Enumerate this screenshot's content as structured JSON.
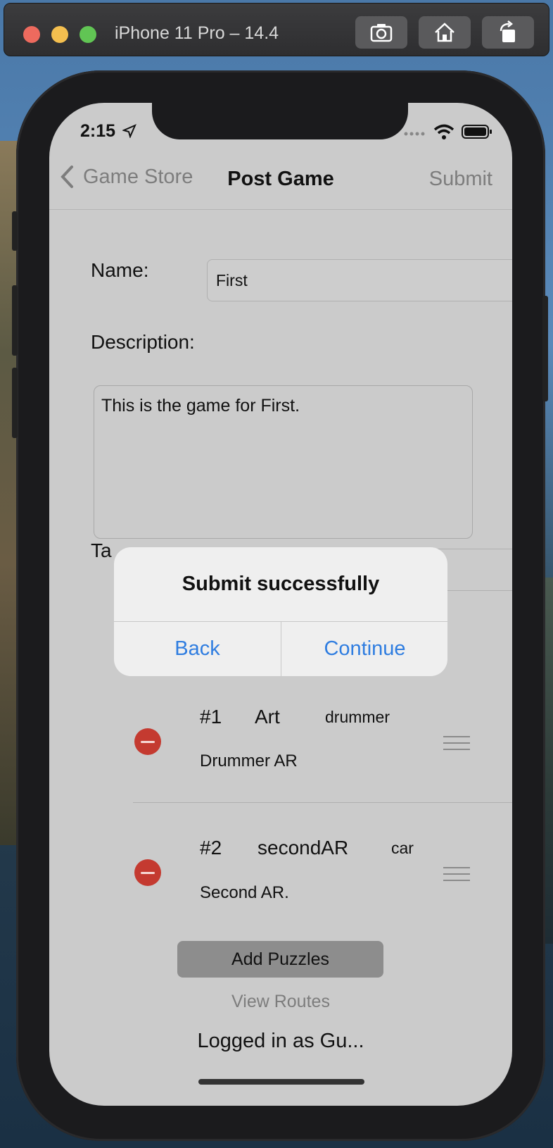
{
  "simulator": {
    "title": "iPhone 11 Pro – 14.4",
    "buttons": [
      "screenshot-icon",
      "home-icon",
      "rotate-icon"
    ]
  },
  "status_bar": {
    "time": "2:15"
  },
  "nav": {
    "back_label": "Game Store",
    "title": "Post Game",
    "submit_label": "Submit"
  },
  "form": {
    "name_label": "Name:",
    "name_value": "First",
    "description_label": "Description:",
    "description_value": "This is the game for First.",
    "tags_label_partial": "Ta"
  },
  "puzzles": [
    {
      "number": "#1",
      "name": "Art",
      "target": "drummer",
      "description": "Drummer AR"
    },
    {
      "number": "#2",
      "name": "secondAR",
      "target": "car",
      "description": "Second AR."
    }
  ],
  "actions": {
    "add_puzzles": "Add Puzzles",
    "view_routes": "View Routes",
    "logged_in": "Logged in as Gu..."
  },
  "alert": {
    "title": "Submit successfully",
    "back": "Back",
    "continue": "Continue"
  },
  "colors": {
    "accent": "#2f7de0",
    "delete": "#c43a30",
    "dim_overlay": "#cbcbcb"
  }
}
